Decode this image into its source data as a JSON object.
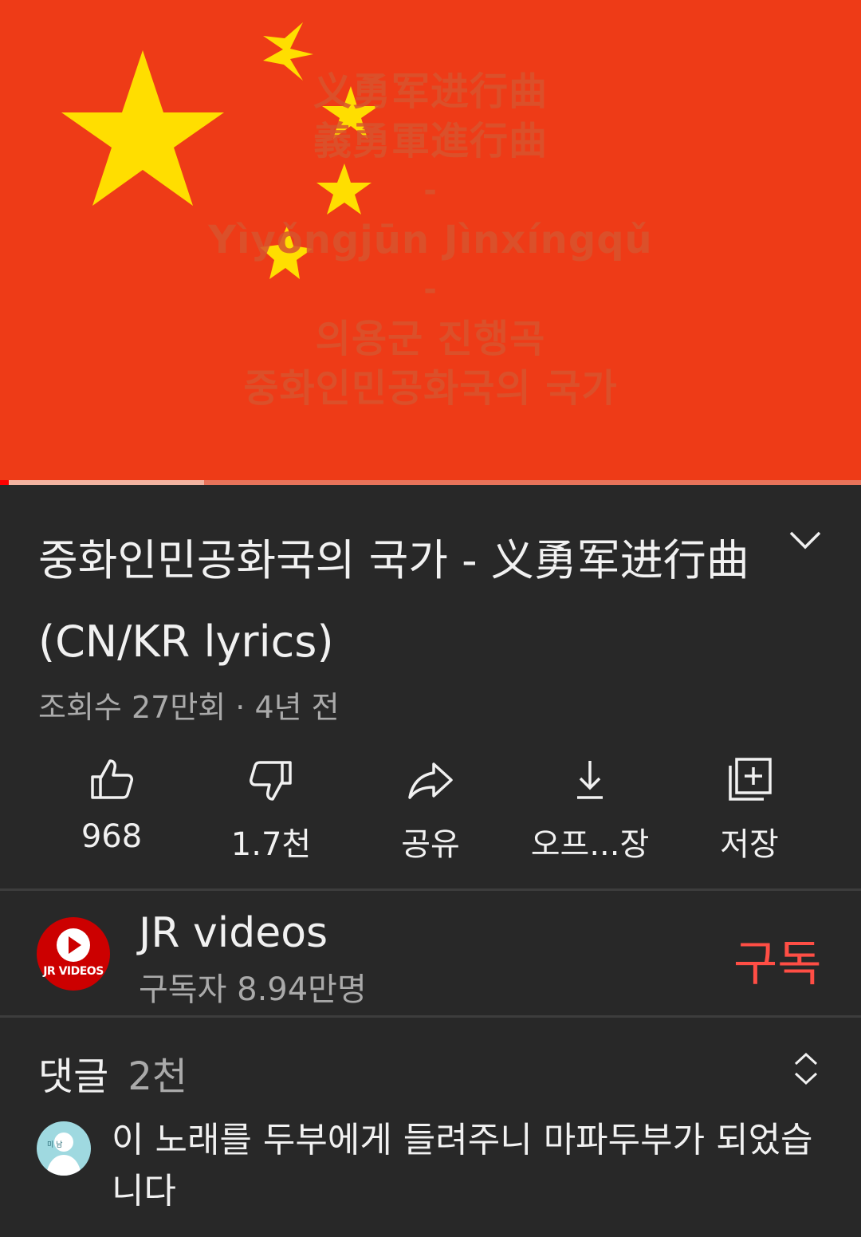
{
  "video": {
    "overlay_lines": [
      "义勇军进行曲",
      "義勇軍進行曲",
      "-",
      "Yìyǒngjūn Jìnxíngqǔ",
      "-",
      "의용군 진행곡",
      "중화인민공화국의 국가"
    ],
    "flag_color": "#ee3b17",
    "star_color": "#ffde00",
    "progress_played": 0.01,
    "progress_buffered": 0.237
  },
  "title": "중화인민공화국의 국가 - 义勇军进行曲 (CN/KR lyrics)",
  "meta": "조회수 27만회 · 4년 전",
  "actions": [
    {
      "icon": "thumbs-up-icon",
      "label": "968"
    },
    {
      "icon": "thumbs-down-icon",
      "label": "1.7천"
    },
    {
      "icon": "share-icon",
      "label": "공유"
    },
    {
      "icon": "download-icon",
      "label": "오프...장"
    },
    {
      "icon": "save-to-playlist-icon",
      "label": "저장"
    }
  ],
  "channel": {
    "avatar_text": "JR VIDEOS",
    "name": "JR videos",
    "subscribers": "구독자 8.94만명",
    "subscribe_label": "구독",
    "subscribe_color": "#ff4e45"
  },
  "comments": {
    "label": "댓글",
    "count": "2천",
    "sort_icon": "expand-collapse-icon",
    "top_comment": {
      "avatar_text": "미 남",
      "text": "이 노래를 두부에게 들려주니 마파두부가 되었습니다"
    }
  }
}
